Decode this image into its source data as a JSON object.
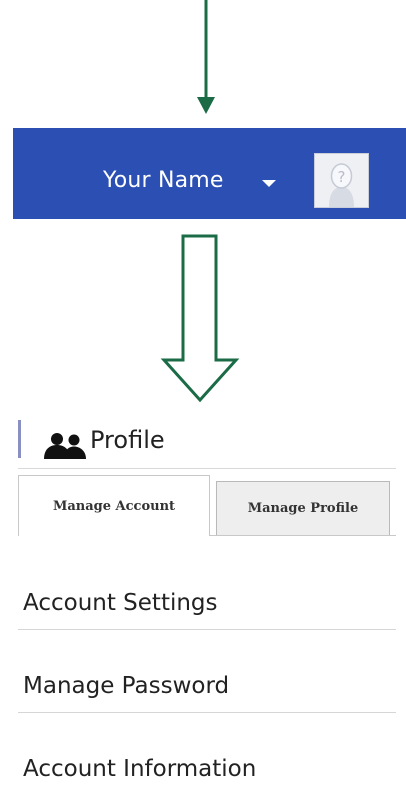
{
  "header": {
    "user_name": "Your Name",
    "caret_icon": "caret-down-icon",
    "avatar_icon": "placeholder-avatar-icon",
    "background": "#2b4fb3"
  },
  "annotations": {
    "arrow_color": "#1a6b46"
  },
  "profile": {
    "title": "Profile",
    "icon": "people-icon",
    "tabs": [
      {
        "label": "Manage Account",
        "active": true
      },
      {
        "label": "Manage Profile",
        "active": false
      }
    ],
    "menu": [
      {
        "label": "Account Settings"
      },
      {
        "label": "Manage Password"
      },
      {
        "label": "Account Information"
      }
    ]
  }
}
